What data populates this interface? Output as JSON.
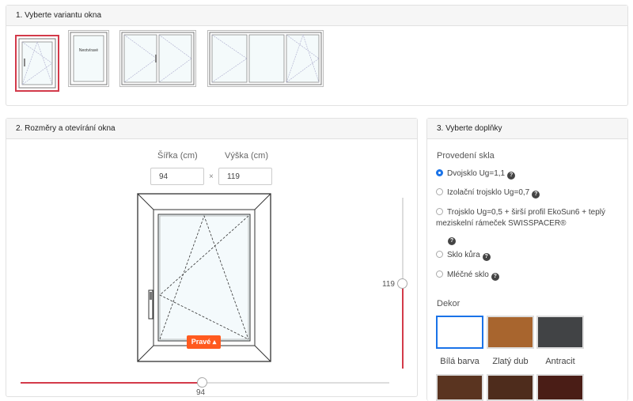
{
  "section1": {
    "title": "1. Vyberte variantu okna",
    "variants": [
      {
        "name": "single-tilt-turn"
      },
      {
        "name": "fixed",
        "label": "Neotvíravé"
      },
      {
        "name": "double"
      },
      {
        "name": "triple"
      }
    ]
  },
  "section2": {
    "title": "2. Rozměry a otevírání okna",
    "width_label": "Šířka (cm)",
    "height_label": "Výška (cm)",
    "width_value": "94",
    "height_value": "119",
    "times": "×",
    "side_button": "Pravé ▴",
    "width_slider_value": "94",
    "height_slider_value": "119"
  },
  "section3": {
    "title": "3. Vyberte doplňky",
    "glass_title": "Provedení skla",
    "glass_options": [
      {
        "label": "Dvojsklo Ug=1,1",
        "checked": true
      },
      {
        "label": "Izolační trojsklo Ug=0,7",
        "checked": false
      },
      {
        "label": "Trojsklo Ug=0,5 + širší profil EkoSun6 + teplý meziskelní rámeček SWISSPACER®",
        "checked": false
      },
      {
        "label": "Sklo kůra",
        "checked": false
      },
      {
        "label": "Mléčné sklo",
        "checked": false
      }
    ],
    "help": "?",
    "decor_title": "Dekor",
    "decors": [
      {
        "label": "Bílá barva",
        "color": "#ffffff"
      },
      {
        "label": "Zlatý dub",
        "color": "#a8652e"
      },
      {
        "label": "Antracit",
        "color": "#414345"
      }
    ],
    "decor_row2_colors": [
      "#5a3420",
      "#4e2c1c",
      "#4a1d16"
    ]
  },
  "colors": {
    "accent_red": "#d33a4a",
    "accent_blue": "#1a73e8",
    "button_orange": "#ff5a1f"
  }
}
